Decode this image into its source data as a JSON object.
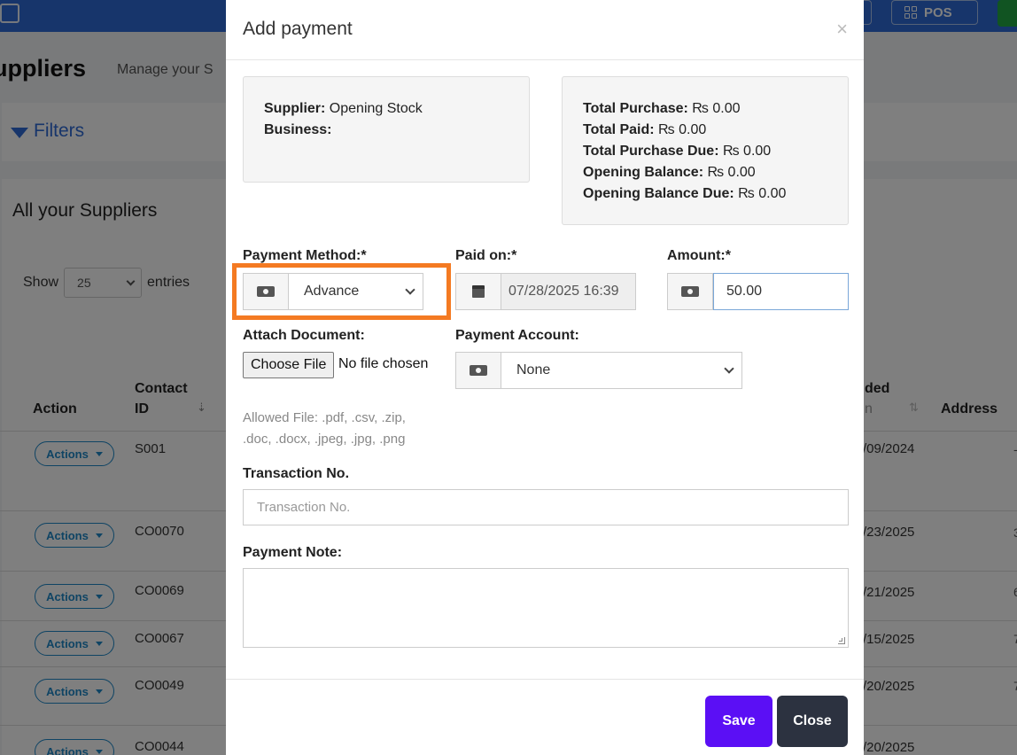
{
  "topbar": {
    "pos_label": "POS",
    "brand_color": "#2f6bd6"
  },
  "page": {
    "title": "uppliers",
    "subtitle": "Manage your S",
    "filters_label": "Filters",
    "list_title": "All your Suppliers",
    "show_label": "Show",
    "show_value": "25",
    "entries_label": "entries"
  },
  "table": {
    "headers": {
      "action": "Action",
      "contact_id_line1": "Contact",
      "contact_id_line2": "ID",
      "added_on_line1": "ded",
      "added_on_line2": "n",
      "address": "Address"
    },
    "actions_label": "Actions",
    "rows": [
      {
        "contact_id": "S001",
        "date": "/09/2024",
        "edge": "-"
      },
      {
        "contact_id": "CO0070",
        "date": "/23/2025",
        "edge": "3"
      },
      {
        "contact_id": "CO0069",
        "date": "/21/2025",
        "edge": "6"
      },
      {
        "contact_id": "CO0067",
        "date": "/15/2025",
        "edge": "7"
      },
      {
        "contact_id": "CO0049",
        "date": "/20/2025",
        "edge": "7"
      },
      {
        "contact_id": "CO0044",
        "date": "/20/2025",
        "edge": ""
      }
    ]
  },
  "modal": {
    "title": "Add payment",
    "close_symbol": "×",
    "supplier": {
      "supplier_label": "Supplier:",
      "supplier_value": "Opening Stock",
      "business_label": "Business:",
      "business_value": ""
    },
    "totals": [
      {
        "label": "Total Purchase:",
        "value": "₨ 0.00"
      },
      {
        "label": "Total Paid:",
        "value": "₨ 0.00"
      },
      {
        "label": "Total Purchase Due:",
        "value": "₨ 0.00"
      },
      {
        "label": "Opening Balance:",
        "value": "₨ 0.00"
      },
      {
        "label": "Opening Balance Due:",
        "value": "₨ 0.00"
      }
    ],
    "payment_method": {
      "label": "Payment Method:*",
      "value": "Advance",
      "highlight_color": "#f47a22"
    },
    "paid_on": {
      "label": "Paid on:*",
      "value": "07/28/2025 16:39"
    },
    "amount": {
      "label": "Amount:*",
      "value": "50.00"
    },
    "attach": {
      "label": "Attach Document:",
      "button": "Choose File",
      "status": "No file chosen",
      "help_line1": "Allowed File: .pdf, .csv, .zip,",
      "help_line2": ".doc, .docx, .jpeg, .jpg, .png"
    },
    "payment_account": {
      "label": "Payment Account:",
      "value": "None"
    },
    "transaction": {
      "label": "Transaction No.",
      "placeholder": "Transaction No."
    },
    "note": {
      "label": "Payment Note:",
      "value": ""
    },
    "save_label": "Save",
    "close_label": "Close",
    "save_color": "#5b0ff5",
    "close_color": "#2c3240"
  }
}
